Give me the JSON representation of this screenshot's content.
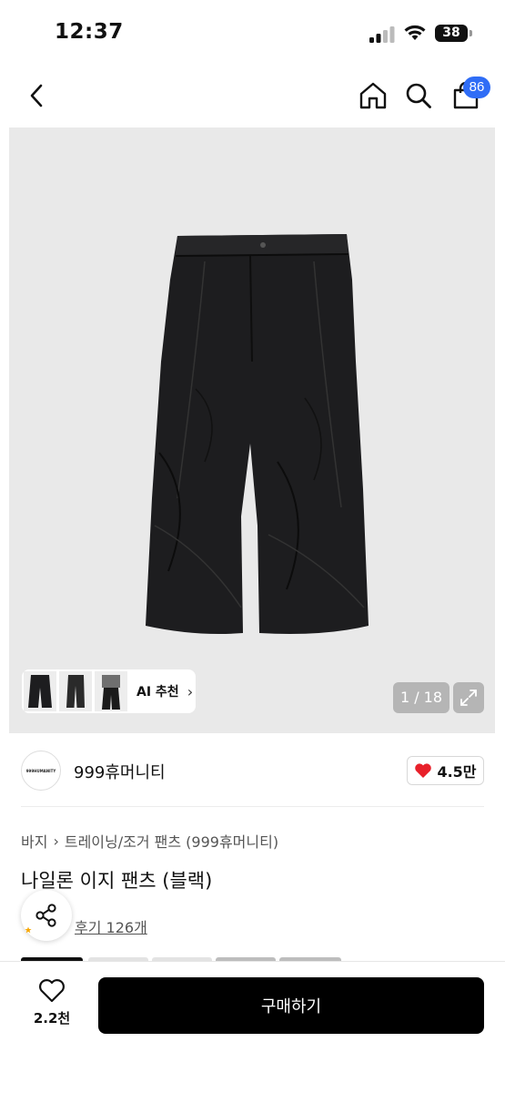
{
  "status_bar": {
    "time": "12:37",
    "battery": "38",
    "battery_level": 0.38
  },
  "nav": {
    "cart_badge": "86"
  },
  "gallery": {
    "ai_label": "AI 추천",
    "counter": "1 / 18",
    "thumbnails": [
      "wide-pants-thumb",
      "straight-pants-thumb",
      "model-thumb"
    ]
  },
  "brand": {
    "logo_text": "999HUMANITY",
    "name": "999휴머니티",
    "likes": "4.5만"
  },
  "breadcrumb": {
    "level1": "바지",
    "level2": "트레이닝/조거 팬츠 (999휴머니티)"
  },
  "product": {
    "title": "나일론 이지 팬츠 (블랙)",
    "reviews": "후기 126개"
  },
  "bottom": {
    "wish_count": "2.2천",
    "buy_label": "구매하기"
  },
  "colors": {
    "accent_badge": "#2f6df6",
    "heart": "#e8202a",
    "buy_bg": "#000000"
  }
}
